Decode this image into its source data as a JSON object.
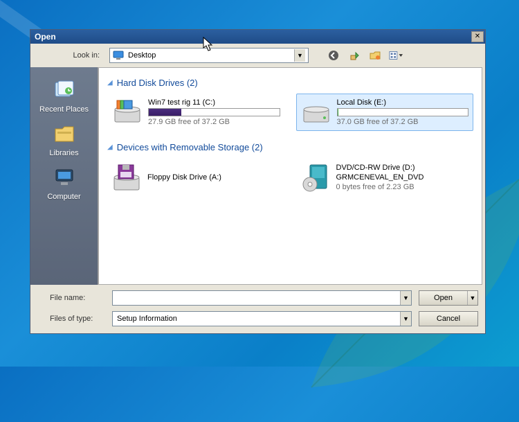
{
  "dialog": {
    "title": "Open",
    "lookin_label": "Look in:",
    "lookin_value": "Desktop"
  },
  "sidebar": {
    "items": [
      {
        "label": "Recent Places"
      },
      {
        "label": "Libraries"
      },
      {
        "label": "Computer"
      }
    ]
  },
  "groups": {
    "hdd": {
      "title": "Hard Disk Drives (2)"
    },
    "rem": {
      "title": "Devices with Removable Storage (2)"
    }
  },
  "drives": [
    {
      "name": "Win7 test rig 11 (C:)",
      "free": "27.9 GB free of 37.2 GB",
      "fill_pct": 25,
      "selected": false,
      "color": "purple"
    },
    {
      "name": "Local Disk (E:)",
      "free": "37.0 GB free of 37.2 GB",
      "fill_pct": 1,
      "selected": true,
      "color": "green"
    }
  ],
  "devices": [
    {
      "line1": "Floppy Disk Drive (A:)",
      "line2": "",
      "line3": ""
    },
    {
      "line1": "DVD/CD-RW Drive (D:)",
      "line2": "GRMCENEVAL_EN_DVD",
      "line3": "0 bytes free of 2.23 GB"
    }
  ],
  "bottom": {
    "filename_label": "File name:",
    "filename_value": "",
    "filetype_label": "Files of type:",
    "filetype_value": "Setup Information",
    "open_label": "Open",
    "cancel_label": "Cancel"
  }
}
